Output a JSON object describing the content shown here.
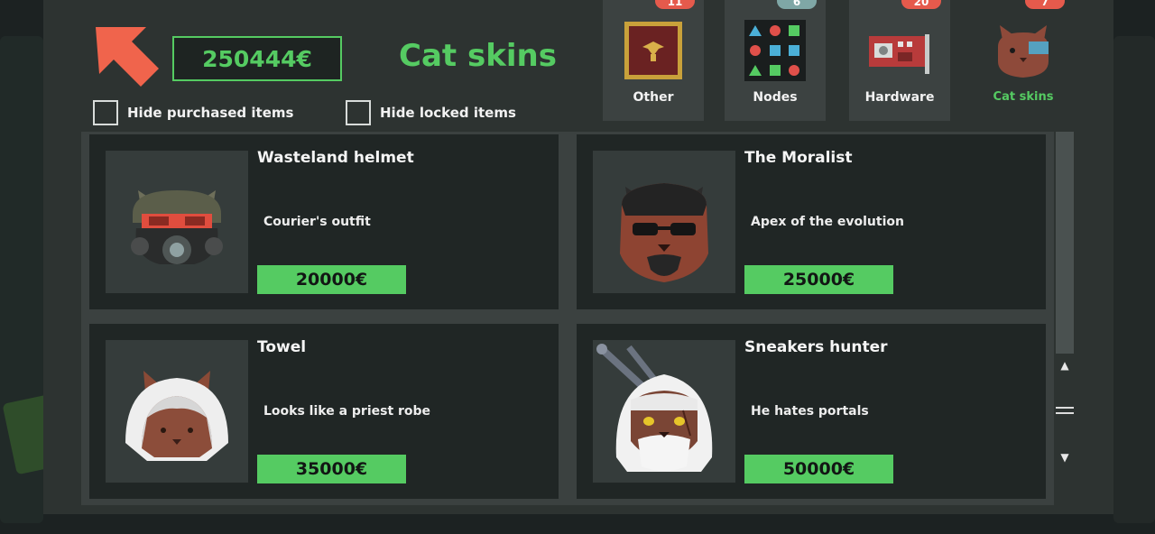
{
  "header": {
    "coins": "250444€",
    "title": "Cat skins"
  },
  "filters": {
    "hide_purchased": "Hide purchased items",
    "hide_locked": "Hide locked items"
  },
  "tabs": [
    {
      "label": "Other",
      "badge": "11",
      "badge_color": "#e55a4c"
    },
    {
      "label": "Nodes",
      "badge": "6",
      "badge_color": "#7fa7a6"
    },
    {
      "label": "Hardware",
      "badge": "20",
      "badge_color": "#e55a4c"
    },
    {
      "label": "Cat skins",
      "badge": "7",
      "badge_color": "#e55a4c"
    }
  ],
  "items": [
    {
      "name": "Wasteland helmet",
      "description": "Courier's outfit",
      "price": "20000€"
    },
    {
      "name": "The Moralist",
      "description": "Apex of the evolution",
      "price": "25000€"
    },
    {
      "name": "Towel",
      "description": "Looks like a priest robe",
      "price": "35000€"
    },
    {
      "name": "Sneakers hunter",
      "description": "He hates portals",
      "price": "50000€"
    }
  ],
  "colors": {
    "accent_green": "#55cb62",
    "badge_red": "#e55a4c",
    "back_arrow": "#f0644c"
  }
}
